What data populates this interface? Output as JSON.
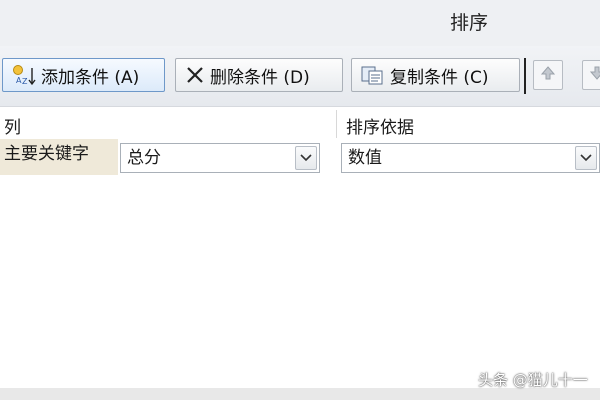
{
  "dialog": {
    "title": "排序"
  },
  "toolbar": {
    "add_label": "添加条件 (A)",
    "delete_label": "删除条件 (D)",
    "copy_label": "复制条件 (C)"
  },
  "table": {
    "header_column": "列",
    "header_sort_on": "排序依据",
    "row_label": "主要关键字",
    "column_value": "总分",
    "sort_on_value": "数值"
  },
  "watermark": "头条 @猫儿十一",
  "icons": {
    "add": "add-condition-icon",
    "delete": "delete-x-icon",
    "copy": "copy-icon",
    "up": "arrow-up-icon",
    "down": "arrow-down-icon",
    "dropdown": "chevron-down-icon"
  }
}
